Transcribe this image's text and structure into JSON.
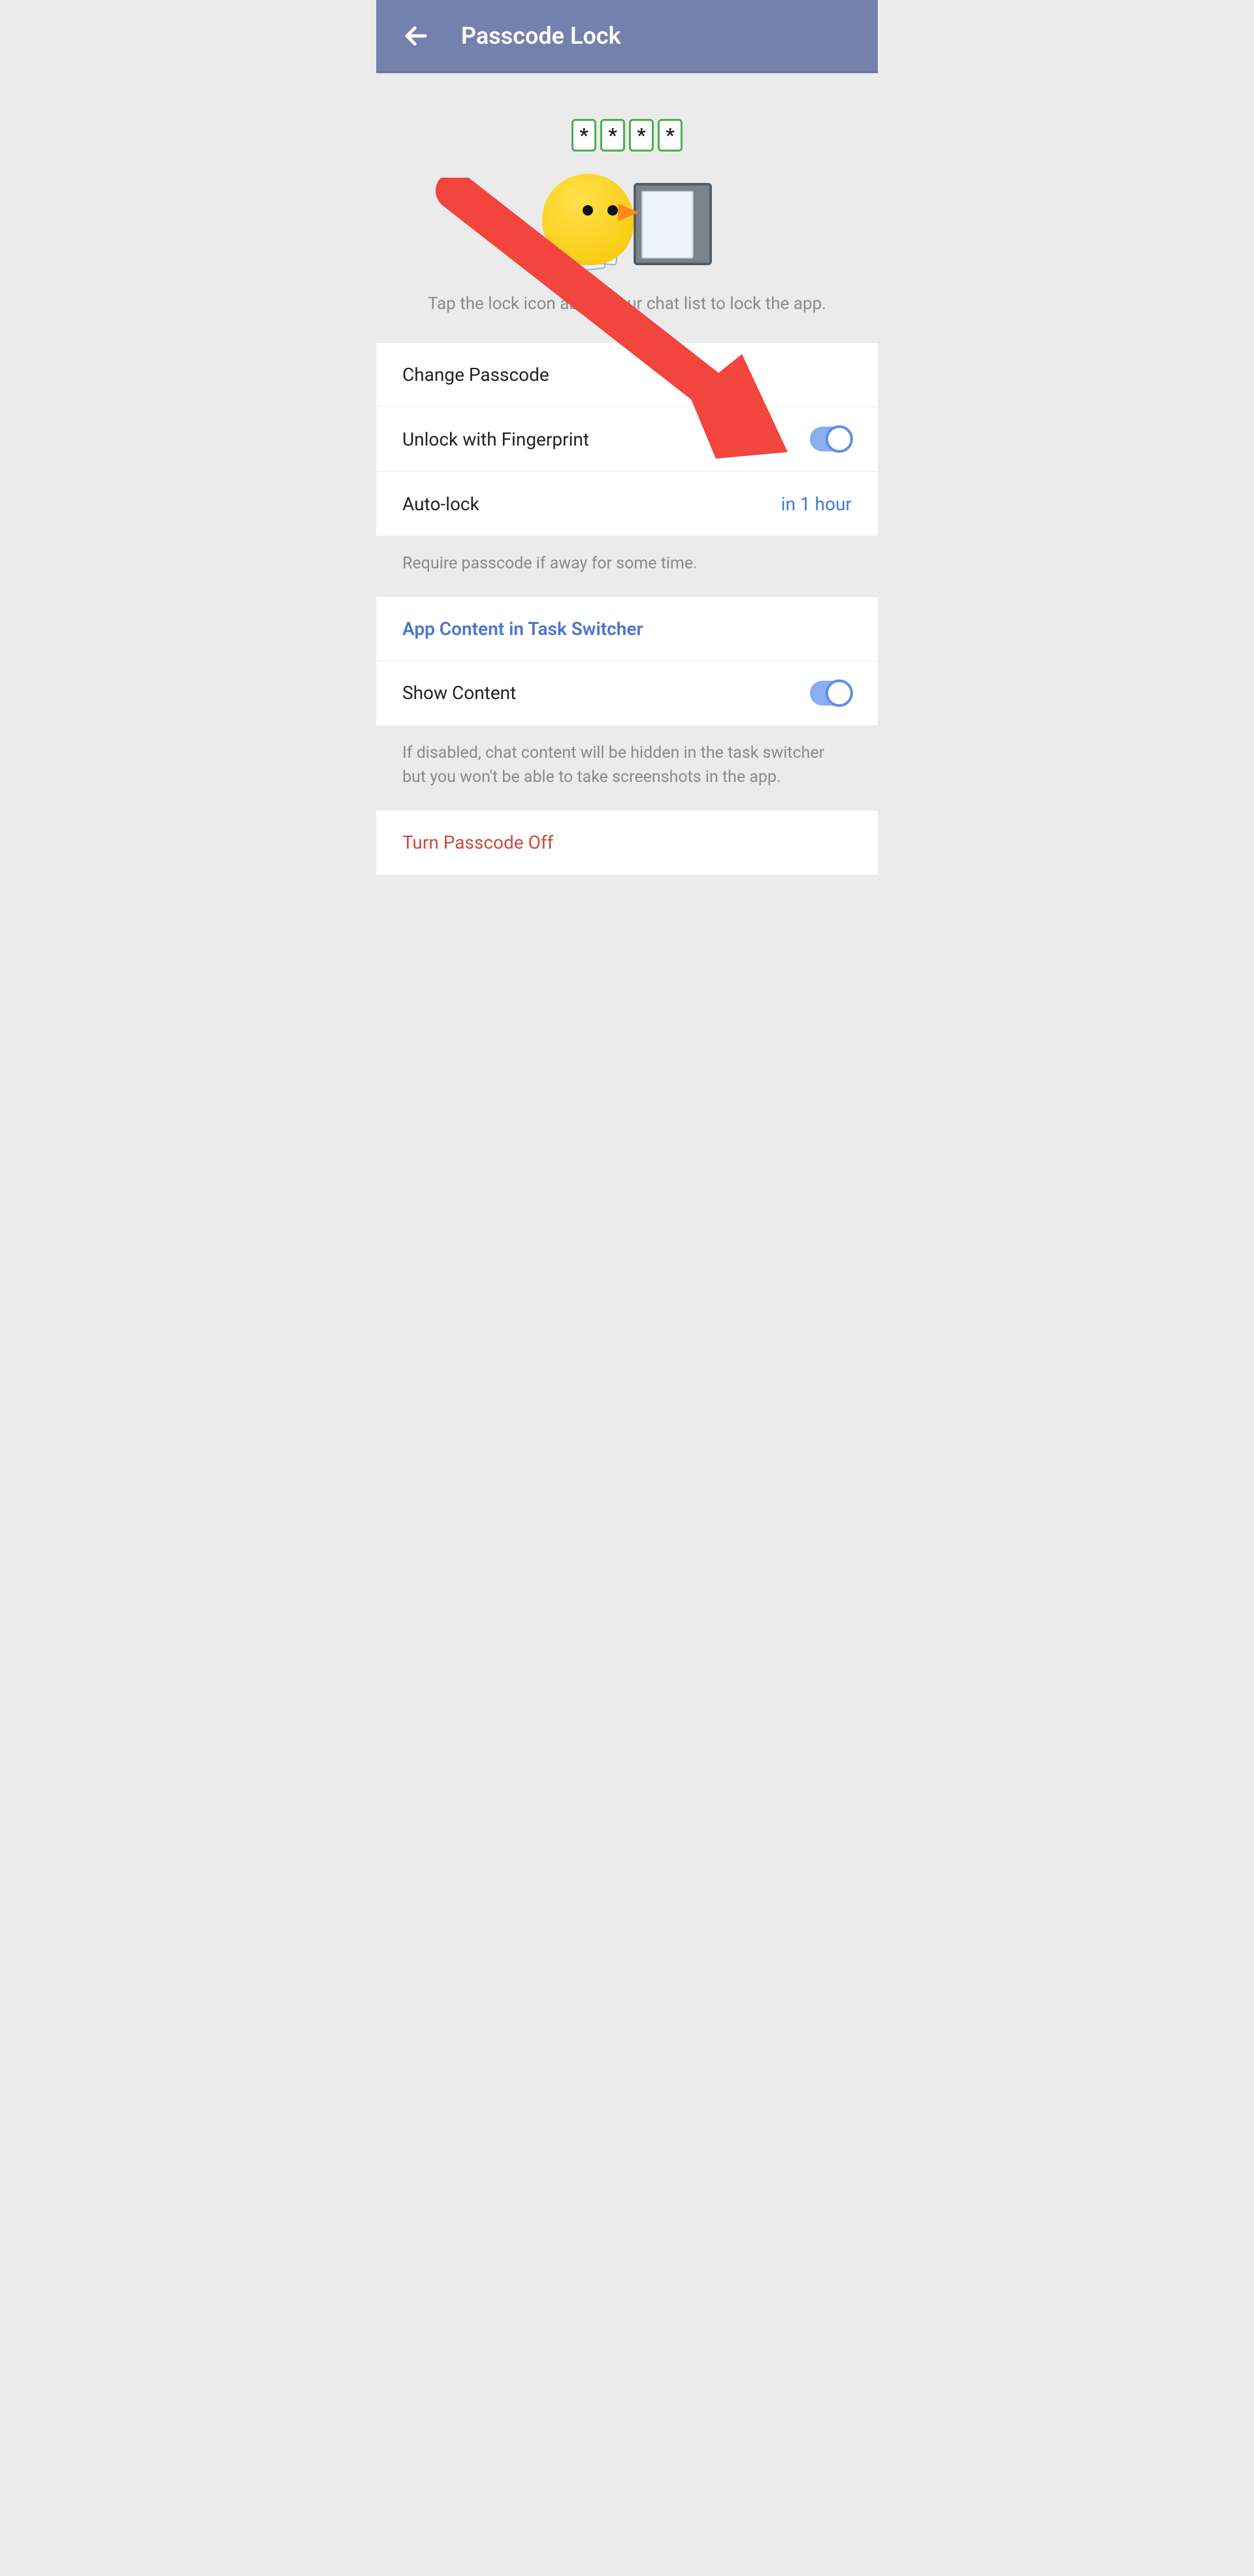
{
  "header": {
    "title": "Passcode Lock"
  },
  "hero": {
    "pin_mask": "*",
    "caption": "Tap the lock icon above your chat list to lock the app."
  },
  "rows": {
    "change_passcode": "Change Passcode",
    "unlock_fingerprint": "Unlock with Fingerprint",
    "auto_lock_label": "Auto-lock",
    "auto_lock_value": "in 1 hour",
    "auto_lock_hint": "Require passcode if away for some time.",
    "task_switcher_header": "App Content in Task Switcher",
    "show_content": "Show Content",
    "show_content_hint": "If disabled, chat content will be hidden in the task switcher but you won't be able to take screenshots in the app.",
    "turn_off": "Turn Passcode Off"
  },
  "toggles": {
    "fingerprint": true,
    "show_content": true
  }
}
